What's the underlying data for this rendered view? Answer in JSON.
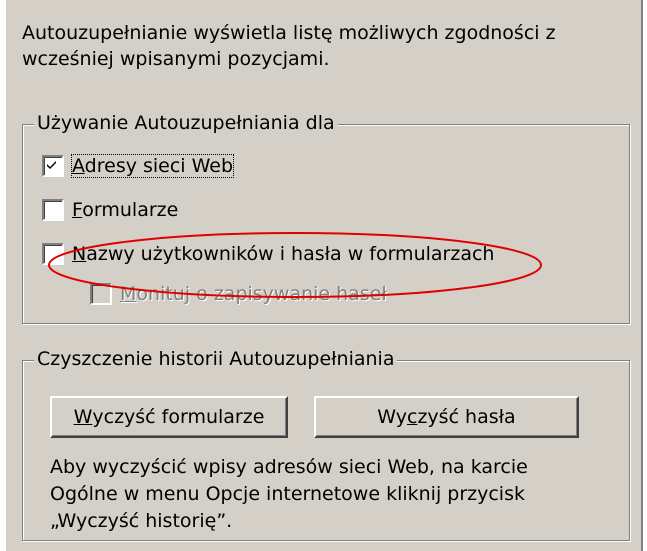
{
  "description": {
    "line1": "Autouzupełnianie wyświetla listę możliwych zgodności z",
    "line2": "wcześniej wpisanymi pozycjami."
  },
  "autocomplete_section": {
    "title": "Używanie Autouzupełniania dla",
    "options": [
      {
        "mnemonic": "A",
        "rest": "dresy sieci Web",
        "checked": true,
        "enabled": true
      },
      {
        "mnemonic": "F",
        "rest": "ormularze",
        "checked": false,
        "enabled": true
      },
      {
        "mnemonic": "N",
        "rest": "azwy użytkowników i hasła w formularzach",
        "checked": false,
        "enabled": true
      },
      {
        "mnemonic": "M",
        "rest": "onituj o zapisywanie haseł",
        "checked": false,
        "enabled": false
      }
    ]
  },
  "clear_section": {
    "title": "Czyszczenie historii Autouzupełniania",
    "clear_forms_button": {
      "before": "",
      "mnemonic": "W",
      "after": "yczyść formularze"
    },
    "clear_passwords_button": {
      "before": "Wy",
      "mnemonic": "c",
      "after": "zyść hasła"
    },
    "note_line1": "Aby wyczyścić wpisy adresów sieci Web, na karcie",
    "note_line2": "Ogólne w menu Opcje internetowe kliknij przycisk",
    "note_line3": "„Wyczyść historię”."
  },
  "colors": {
    "dialog_background": "#d4d0c8",
    "annotation_ellipse": "#e00000",
    "disabled_text": "#808080"
  }
}
